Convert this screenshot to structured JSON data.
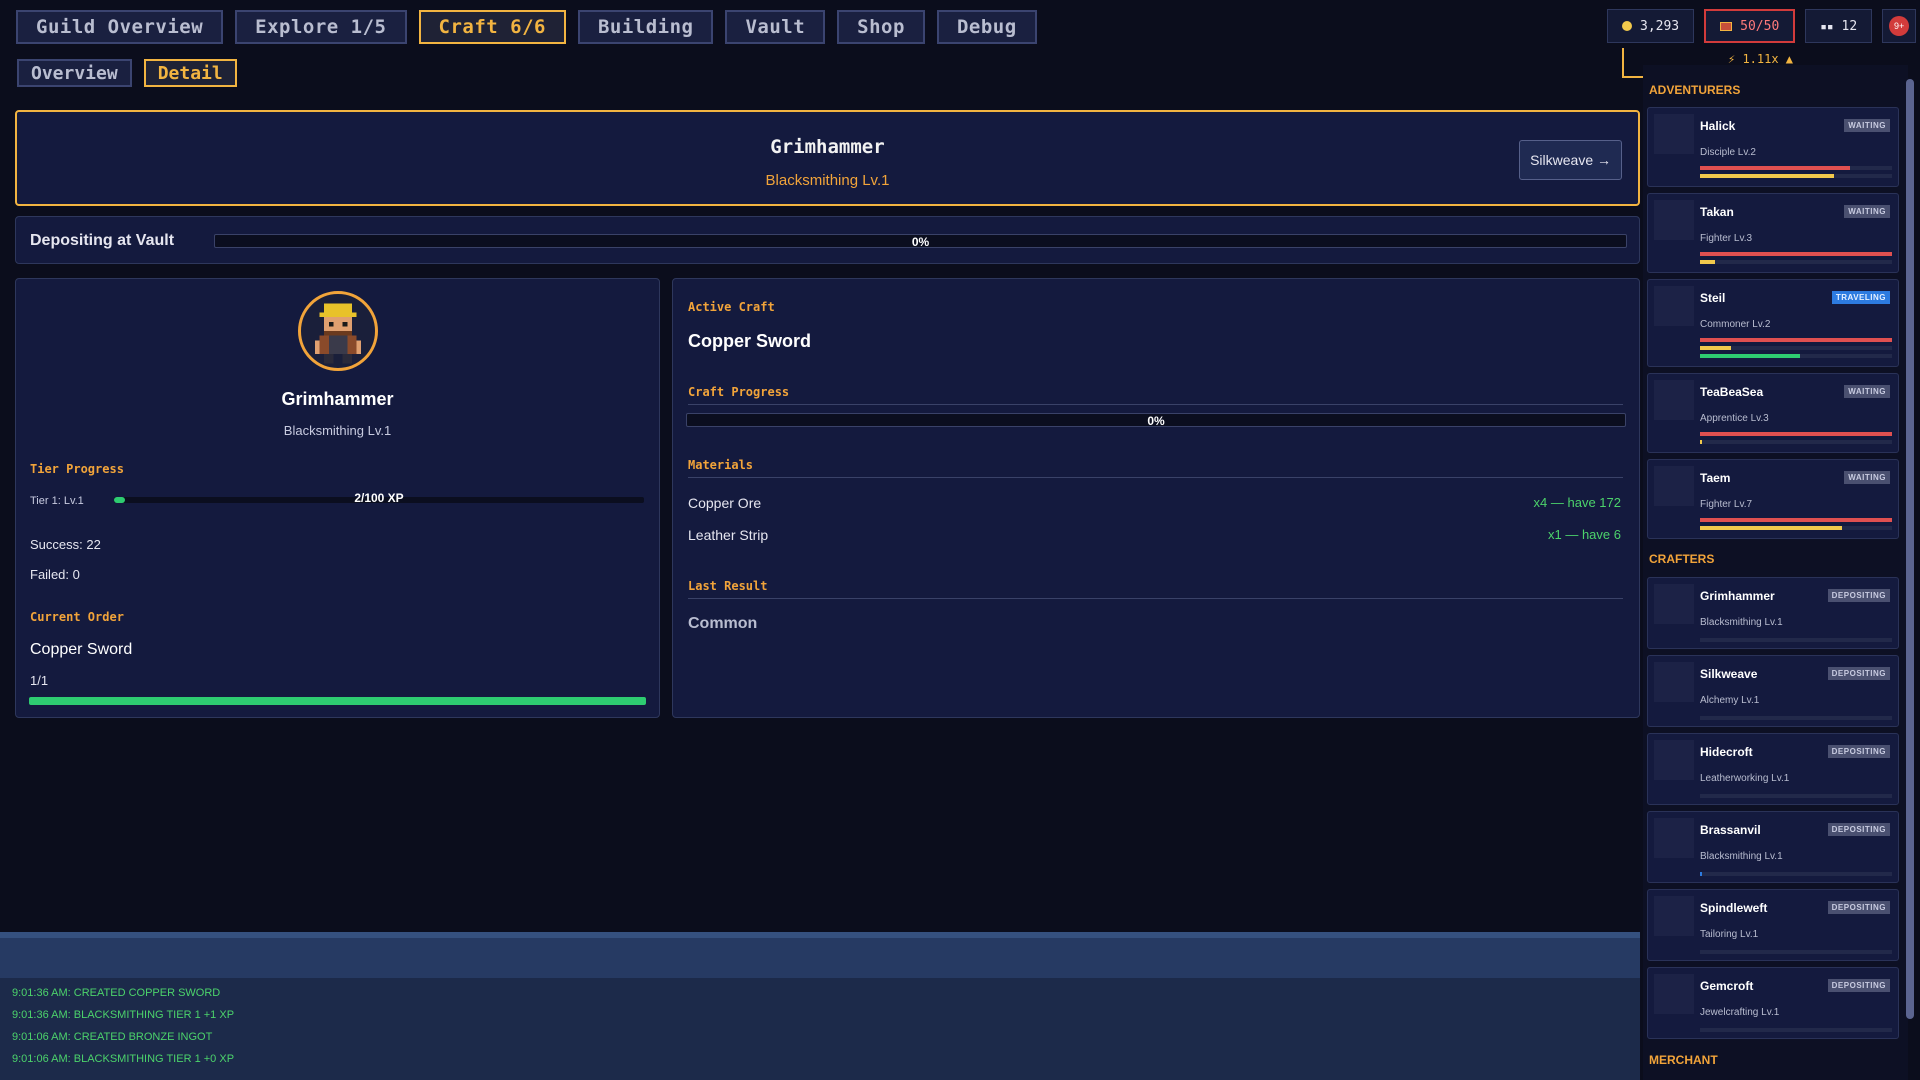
{
  "nav": {
    "tabs": [
      "Guild Overview",
      "Explore 1/5",
      "Craft 6/6",
      "Building",
      "Vault",
      "Shop",
      "Debug"
    ],
    "subtabs": [
      "Overview",
      "Detail"
    ]
  },
  "resources": {
    "gold": "3,293",
    "storage": "50/50",
    "people": "12",
    "notifications": "9+",
    "speed": "1.11x"
  },
  "header": {
    "name": "Grimhammer",
    "subtitle": "Blacksmithing Lv.1",
    "switch_label": "Silkweave →"
  },
  "depositing": {
    "label": "Depositing at Vault",
    "progress": 0,
    "progress_text": "0%"
  },
  "crafter": {
    "name": "Grimhammer",
    "subtitle": "Blacksmithing Lv.1",
    "tier_heading": "Tier Progress",
    "tier_label": "Tier 1: Lv.1",
    "tier_xp_text": "2/100 XP",
    "tier_progress": 0.02,
    "success": "Success: 22",
    "failed": "Failed: 0",
    "order_heading": "Current Order",
    "order_item": "Copper Sword",
    "order_count": "1/1",
    "order_progress": 1.0
  },
  "craft": {
    "active_heading": "Active Craft",
    "active_item": "Copper Sword",
    "progress_heading": "Craft Progress",
    "progress_text": "0%",
    "progress": 0,
    "materials_heading": "Materials",
    "materials": [
      {
        "name": "Copper Ore",
        "need": "x4 — have 172"
      },
      {
        "name": "Leather Strip",
        "need": "x1 — have 6"
      }
    ],
    "last_heading": "Last Result",
    "last_result": "Common"
  },
  "sidebar": {
    "adventurers_heading": "ADVENTURERS",
    "adventurers": [
      {
        "name": "Halick",
        "class": "Disciple Lv.2",
        "status": "WAITING"
      },
      {
        "name": "Takan",
        "class": "Fighter Lv.3",
        "status": "WAITING"
      },
      {
        "name": "Steil",
        "class": "Commoner Lv.2",
        "status": "TRAVELING"
      },
      {
        "name": "TeaBeaSea",
        "class": "Apprentice Lv.3",
        "status": "WAITING"
      },
      {
        "name": "Taem",
        "class": "Fighter Lv.7",
        "status": "WAITING"
      }
    ],
    "crafters_heading": "CRAFTERS",
    "crafters": [
      {
        "name": "Grimhammer",
        "class": "Blacksmithing Lv.1",
        "status": "DEPOSITING"
      },
      {
        "name": "Silkweave",
        "class": "Alchemy Lv.1",
        "status": "DEPOSITING"
      },
      {
        "name": "Hidecroft",
        "class": "Leatherworking Lv.1",
        "status": "DEPOSITING"
      },
      {
        "name": "Brassanvil",
        "class": "Blacksmithing Lv.1",
        "status": "DEPOSITING"
      },
      {
        "name": "Spindleweft",
        "class": "Tailoring Lv.1",
        "status": "DEPOSITING"
      },
      {
        "name": "Gemcroft",
        "class": "Jewelcrafting Lv.1",
        "status": "DEPOSITING"
      }
    ],
    "merchant_heading": "MERCHANT"
  },
  "log": [
    "9:01:36 AM: CREATED COPPER SWORD",
    "9:01:36 AM: BLACKSMITHING TIER 1 +1 XP",
    "9:01:06 AM: CREATED BRONZE INGOT",
    "9:01:06 AM: BLACKSMITHING TIER 1 +0 XP"
  ]
}
